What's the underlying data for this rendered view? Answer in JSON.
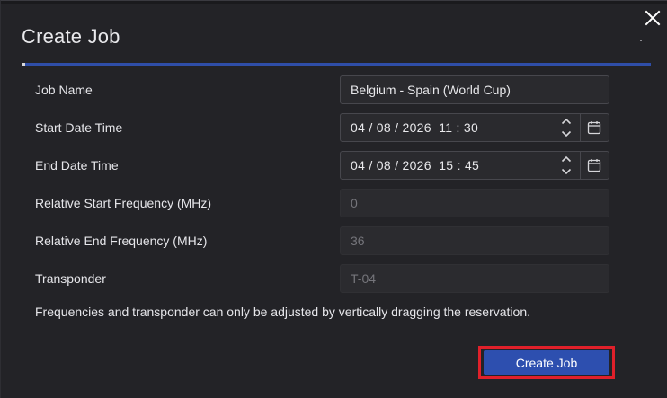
{
  "dialog": {
    "title": "Create Job",
    "close_icon": "close-icon",
    "accent_color": "#2f4ea8"
  },
  "form": {
    "job_name": {
      "label": "Job Name",
      "value": "Belgium - Spain (World Cup)"
    },
    "start_datetime": {
      "label": "Start Date Time",
      "value": "04 / 08 / 2026  11 : 30"
    },
    "end_datetime": {
      "label": "End Date Time",
      "value": "04 / 08 / 2026  15 : 45"
    },
    "rel_start_freq": {
      "label": "Relative Start Frequency (MHz)",
      "value": "0"
    },
    "rel_end_freq": {
      "label": "Relative End Frequency (MHz)",
      "value": "36"
    },
    "transponder": {
      "label": "Transponder",
      "value": "T-04"
    }
  },
  "note": "Frequencies and transponder can only be adjusted by vertically dragging the reservation.",
  "actions": {
    "create_label": "Create Job",
    "button_color": "#2d4faf",
    "highlight_color": "#e0202a"
  }
}
